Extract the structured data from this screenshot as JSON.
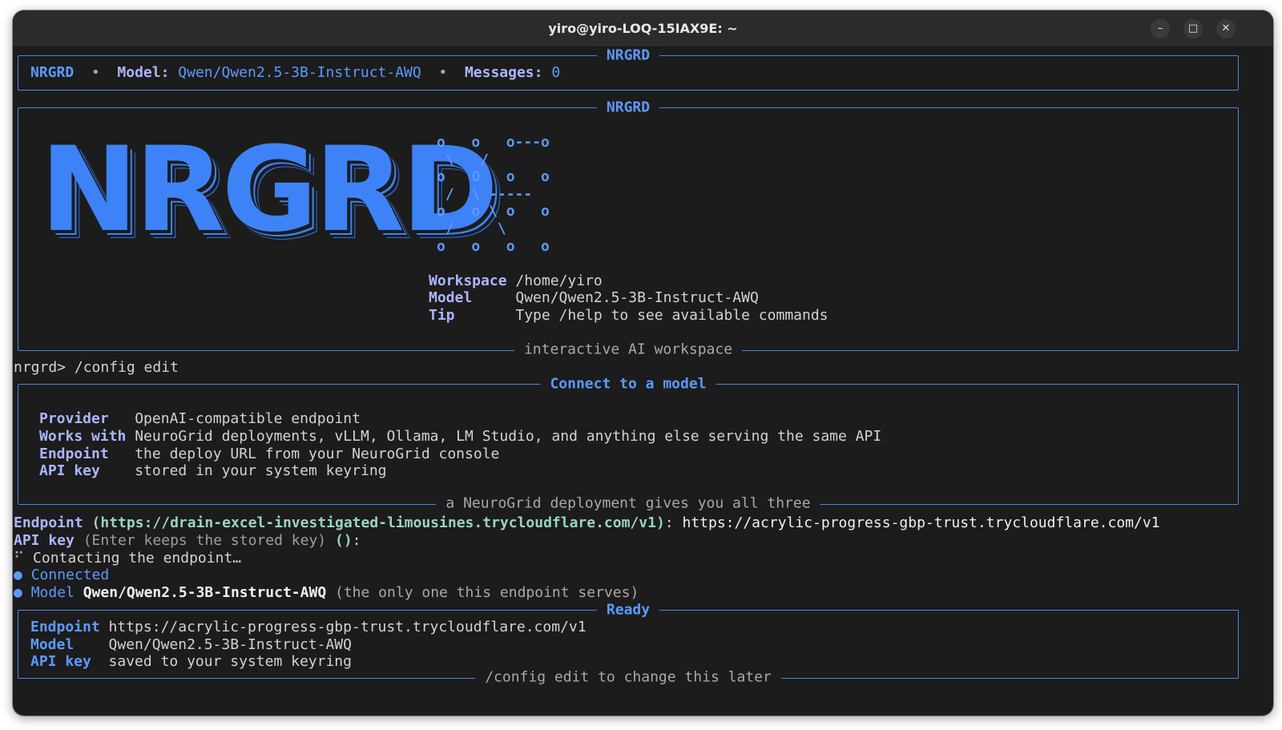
{
  "window": {
    "title": "yiro@yiro-LOQ-15IAX9E: ~"
  },
  "status": {
    "box_title": "NRGRD",
    "app": "NRGRD",
    "sep1": "•",
    "model_label": "Model:",
    "model_value": "Qwen/Qwen2.5-3B-Instruct-AWQ",
    "sep2": "•",
    "messages_label": "Messages:",
    "messages_value": "0"
  },
  "banner": {
    "box_title": "NRGRD",
    "logo_text": "NRGRD",
    "ascii_art": "o   o   o---o\n \\   /\no   O   o   o\n /  \\ -----\no   o \\ o   o\n /     \\\no   o   o   o",
    "workspace_label": "Workspace",
    "workspace_value": "/home/yiro",
    "model_label": "Model",
    "model_value": "Qwen/Qwen2.5-3B-Instruct-AWQ",
    "tip_label": "Tip",
    "tip_value": "Type /help to see available commands",
    "footer": "interactive AI workspace"
  },
  "prompt": {
    "text": "nrgrd> /config edit"
  },
  "connect": {
    "box_title": "Connect to a model",
    "provider_label": "Provider",
    "provider_value": "OpenAI-compatible endpoint",
    "works_label": "Works with",
    "works_value": "NeuroGrid deployments, vLLM, Ollama, LM Studio, and anything else serving the same API",
    "endpoint_label": "Endpoint",
    "endpoint_value": "the deploy URL from your NeuroGrid console",
    "apikey_label": "API key",
    "apikey_value": "stored in your system keyring",
    "footer": "a NeuroGrid deployment gives you all three"
  },
  "log": {
    "endpoint_label": "Endpoint",
    "endpoint_default": "(https://drain-excel-investigated-limousines.trycloudflare.com/v1)",
    "endpoint_colon": ":",
    "endpoint_input": "https://acrylic-progress-gbp-trust.trycloudflare.com/v1",
    "apikey_label": "API key",
    "apikey_hint": "(Enter keeps the stored key)",
    "apikey_default": "()",
    "apikey_colon": ":",
    "spinner": "⠋",
    "contacting": "Contacting the endpoint…",
    "bullet": "●",
    "connected": "Connected",
    "model_label": "Model",
    "model_value": "Qwen/Qwen2.5-3B-Instruct-AWQ",
    "model_note": "(the only one this endpoint serves)"
  },
  "ready": {
    "box_title": "Ready",
    "endpoint_label": "Endpoint",
    "endpoint_value": "https://acrylic-progress-gbp-trust.trycloudflare.com/v1",
    "model_label": "Model",
    "model_value": "Qwen/Qwen2.5-3B-Instruct-AWQ",
    "apikey_label": "API key",
    "apikey_value": "saved to your system keyring",
    "footer": "/config edit to change this later"
  },
  "colors": {
    "accent": "#5b9aff",
    "label": "#aab6ff",
    "terminal_bg": "#1c1c1c",
    "border": "#4a86ee",
    "default_hint": "#9ad4c1"
  },
  "icons": [
    "minimize-icon",
    "maximize-icon",
    "close-icon",
    "spinner-icon",
    "bullet-icon"
  ]
}
